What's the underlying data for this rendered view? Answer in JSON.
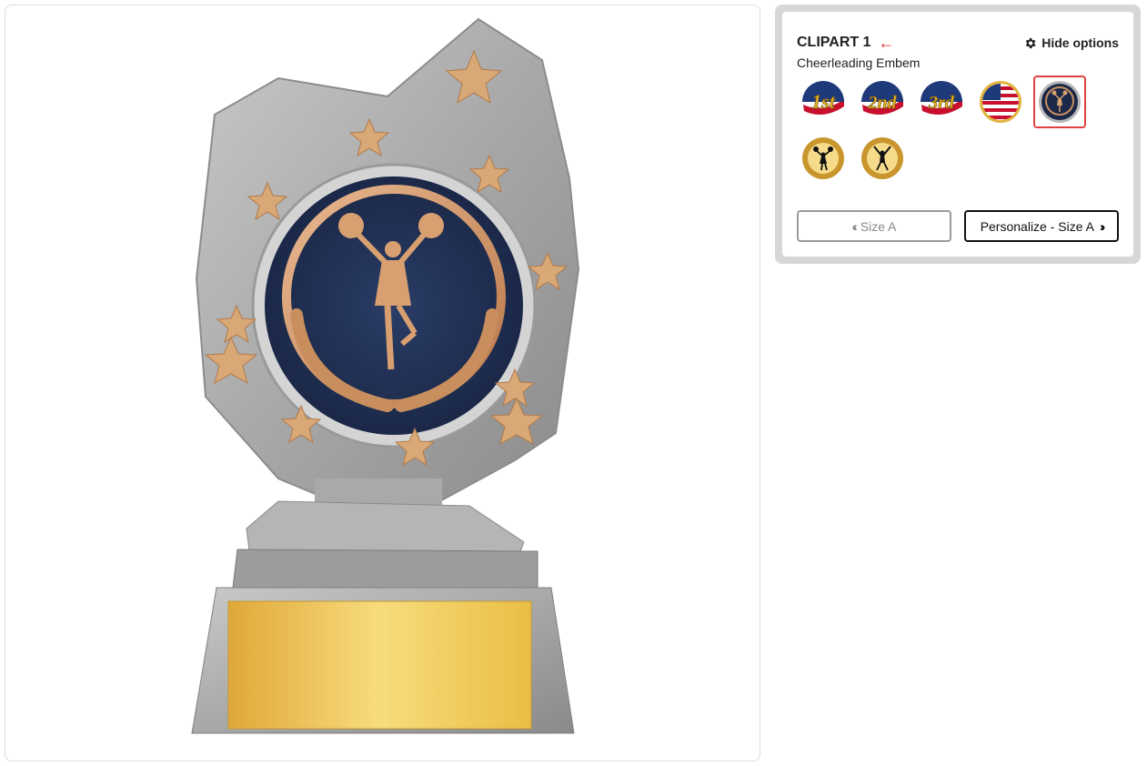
{
  "preview": {
    "product_image": "trophy-cheerleading-star-shield",
    "plate_color": "#f2c94c"
  },
  "options": {
    "title": "CLIPART 1",
    "back_icon": "arrow-left-icon",
    "subtitle": "Cheerleading Embem",
    "hide_label": "Hide options",
    "hide_icon": "gear-icon",
    "clipart_items": [
      {
        "name": "first-place-flag",
        "label": "1st",
        "selected": false
      },
      {
        "name": "second-place-flag",
        "label": "2nd",
        "selected": false
      },
      {
        "name": "third-place-flag",
        "label": "3rd",
        "selected": false
      },
      {
        "name": "american-flag",
        "label": "",
        "selected": false
      },
      {
        "name": "cheerleading-emblem-navy",
        "label": "",
        "selected": true
      },
      {
        "name": "cheerleader-gold-1",
        "label": "",
        "selected": false
      },
      {
        "name": "cheerleader-gold-2",
        "label": "",
        "selected": false
      }
    ],
    "prev_button": "Size A",
    "next_button": "Personalize - Size A"
  },
  "colors": {
    "accent_red": "#e02020",
    "selected_border": "#e04040",
    "panel_bg": "#d7d7d7"
  }
}
